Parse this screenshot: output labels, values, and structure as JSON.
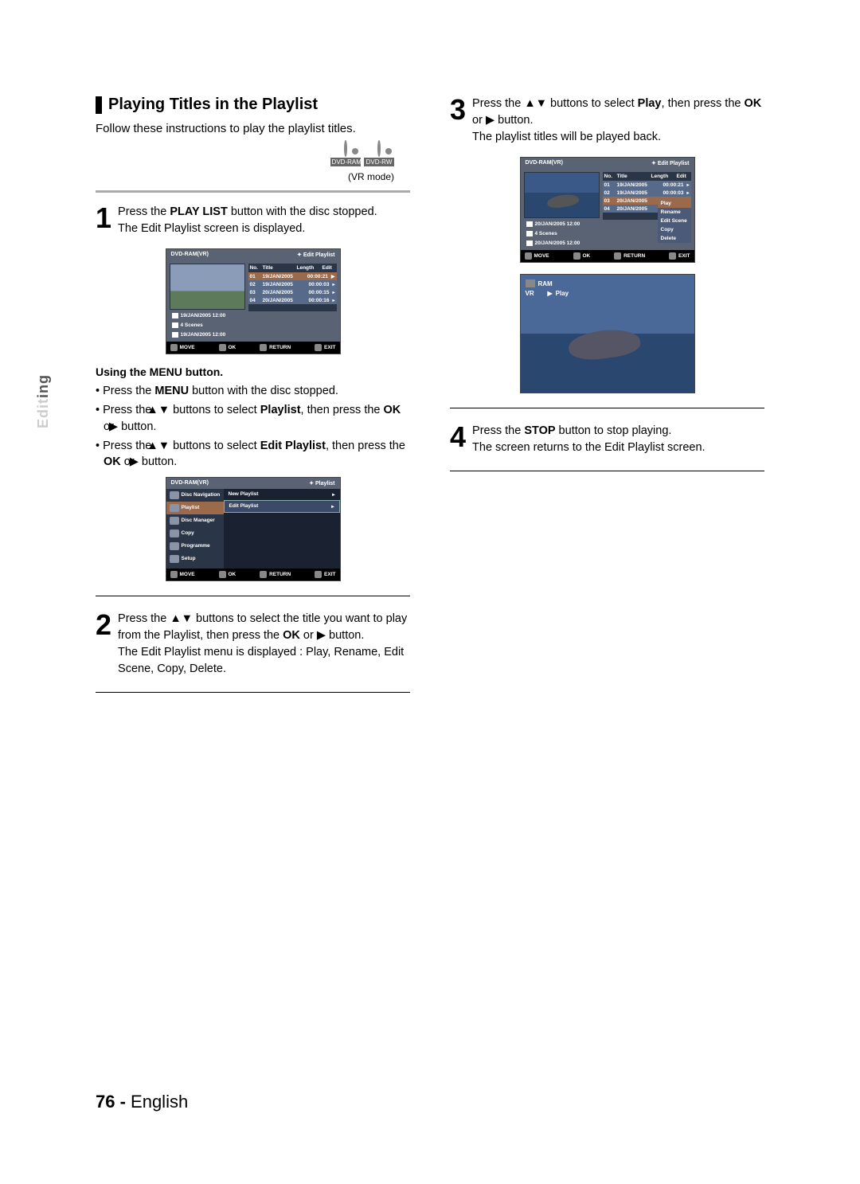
{
  "section_title": "Playing Titles in the Playlist",
  "intro": "Follow these instructions to play the playlist titles.",
  "disc_labels": [
    "DVD-RAM",
    "DVD-RW"
  ],
  "vr_mode": "(VR mode)",
  "step1": {
    "num": "1",
    "text_a": "Press the ",
    "text_b": "PLAY LIST",
    "text_c": " button with the disc stopped.",
    "text_d": "The Edit Playlist screen is displayed."
  },
  "ui1": {
    "header_left": "DVD-RAM(VR)",
    "header_right": "Edit Playlist",
    "cols": {
      "no": "No.",
      "title": "Title",
      "length": "Length",
      "edit": "Edit"
    },
    "rows": [
      {
        "no": "01",
        "title": "19/JAN/2005",
        "len": "00:00:21"
      },
      {
        "no": "02",
        "title": "19/JAN/2005",
        "len": "00:00:03"
      },
      {
        "no": "03",
        "title": "20/JAN/2005",
        "len": "00:00:15"
      },
      {
        "no": "04",
        "title": "20/JAN/2005",
        "len": "00:00:16"
      }
    ],
    "info": [
      "19/JAN/2005 12:00",
      "4 Scenes",
      "19/JAN/2005 12:00"
    ],
    "foot": {
      "move": "MOVE",
      "ok": "OK",
      "return": "RETURN",
      "exit": "EXIT"
    }
  },
  "menu_section": {
    "head": "Using the MENU button.",
    "b1_a": "Press the ",
    "b1_b": "MENU",
    "b1_c": " button with the disc stopped.",
    "b2_a": "Press the ",
    "b2_b": " buttons to select ",
    "b2_c": "Playlist",
    "b2_d": ", then press the ",
    "b2_e": "OK",
    "b2_f": " or ",
    "b2_g": " button.",
    "b3_a": "Press the ",
    "b3_b": " buttons to select ",
    "b3_c": "Edit Playlist",
    "b3_d": ", then press the ",
    "b3_e": "OK",
    "b3_f": " or ",
    "b3_g": " button."
  },
  "ui2": {
    "header_left": "DVD-RAM(VR)",
    "header_right": "Playlist",
    "side": [
      "Disc Navigation",
      "Playlist",
      "Disc Manager",
      "Copy",
      "Programme",
      "Setup"
    ],
    "right": [
      "New Playlist",
      "Edit Playlist"
    ],
    "foot": {
      "move": "MOVE",
      "ok": "OK",
      "return": "RETURN",
      "exit": "EXIT"
    }
  },
  "step2": {
    "num": "2",
    "t1": "Press the ",
    "t2": " buttons to select the title you want to play from the Playlist, then press the ",
    "t3": "OK",
    "t4": " or ",
    "t5": " button.",
    "t6": "The Edit Playlist menu is displayed : Play, Rename, Edit Scene, Copy, Delete."
  },
  "step3": {
    "num": "3",
    "t1": "Press the ",
    "t2": " buttons to select ",
    "t3": "Play",
    "t4": ", then press the ",
    "t5": "OK",
    "t6": " or ",
    "t7": " button.",
    "t8": "The playlist titles will be played back."
  },
  "ui3": {
    "header_left": "DVD-RAM(VR)",
    "header_right": "Edit Playlist",
    "cols": {
      "no": "No.",
      "title": "Title",
      "length": "Length",
      "edit": "Edit"
    },
    "rows": [
      {
        "no": "01",
        "title": "19/JAN/2005",
        "len": "00:00:21"
      },
      {
        "no": "02",
        "title": "19/JAN/2005",
        "len": "00:00:03"
      },
      {
        "no": "03",
        "title": "20/JAN/2005",
        "len": ""
      },
      {
        "no": "04",
        "title": "20/JAN/2005",
        "len": ""
      }
    ],
    "ctx": [
      "Play",
      "Rename",
      "Edit Scene",
      "Copy",
      "Delete"
    ],
    "info": [
      "20/JAN/2005 12:00",
      "4 Scenes",
      "20/JAN/2005 12:00"
    ],
    "foot": {
      "move": "MOVE",
      "ok": "OK",
      "return": "RETURN",
      "exit": "EXIT"
    }
  },
  "play_overlay": {
    "ram": "RAM",
    "vr": "VR",
    "play": "Play"
  },
  "step4": {
    "num": "4",
    "t1": "Press the ",
    "t2": "STOP",
    "t3": " button to stop playing.",
    "t4": "The screen returns to the Edit Playlist screen."
  },
  "side_tab": {
    "dim": "Edit",
    "dark": "ing"
  },
  "footer": {
    "page": "76 - ",
    "lang": "English"
  }
}
